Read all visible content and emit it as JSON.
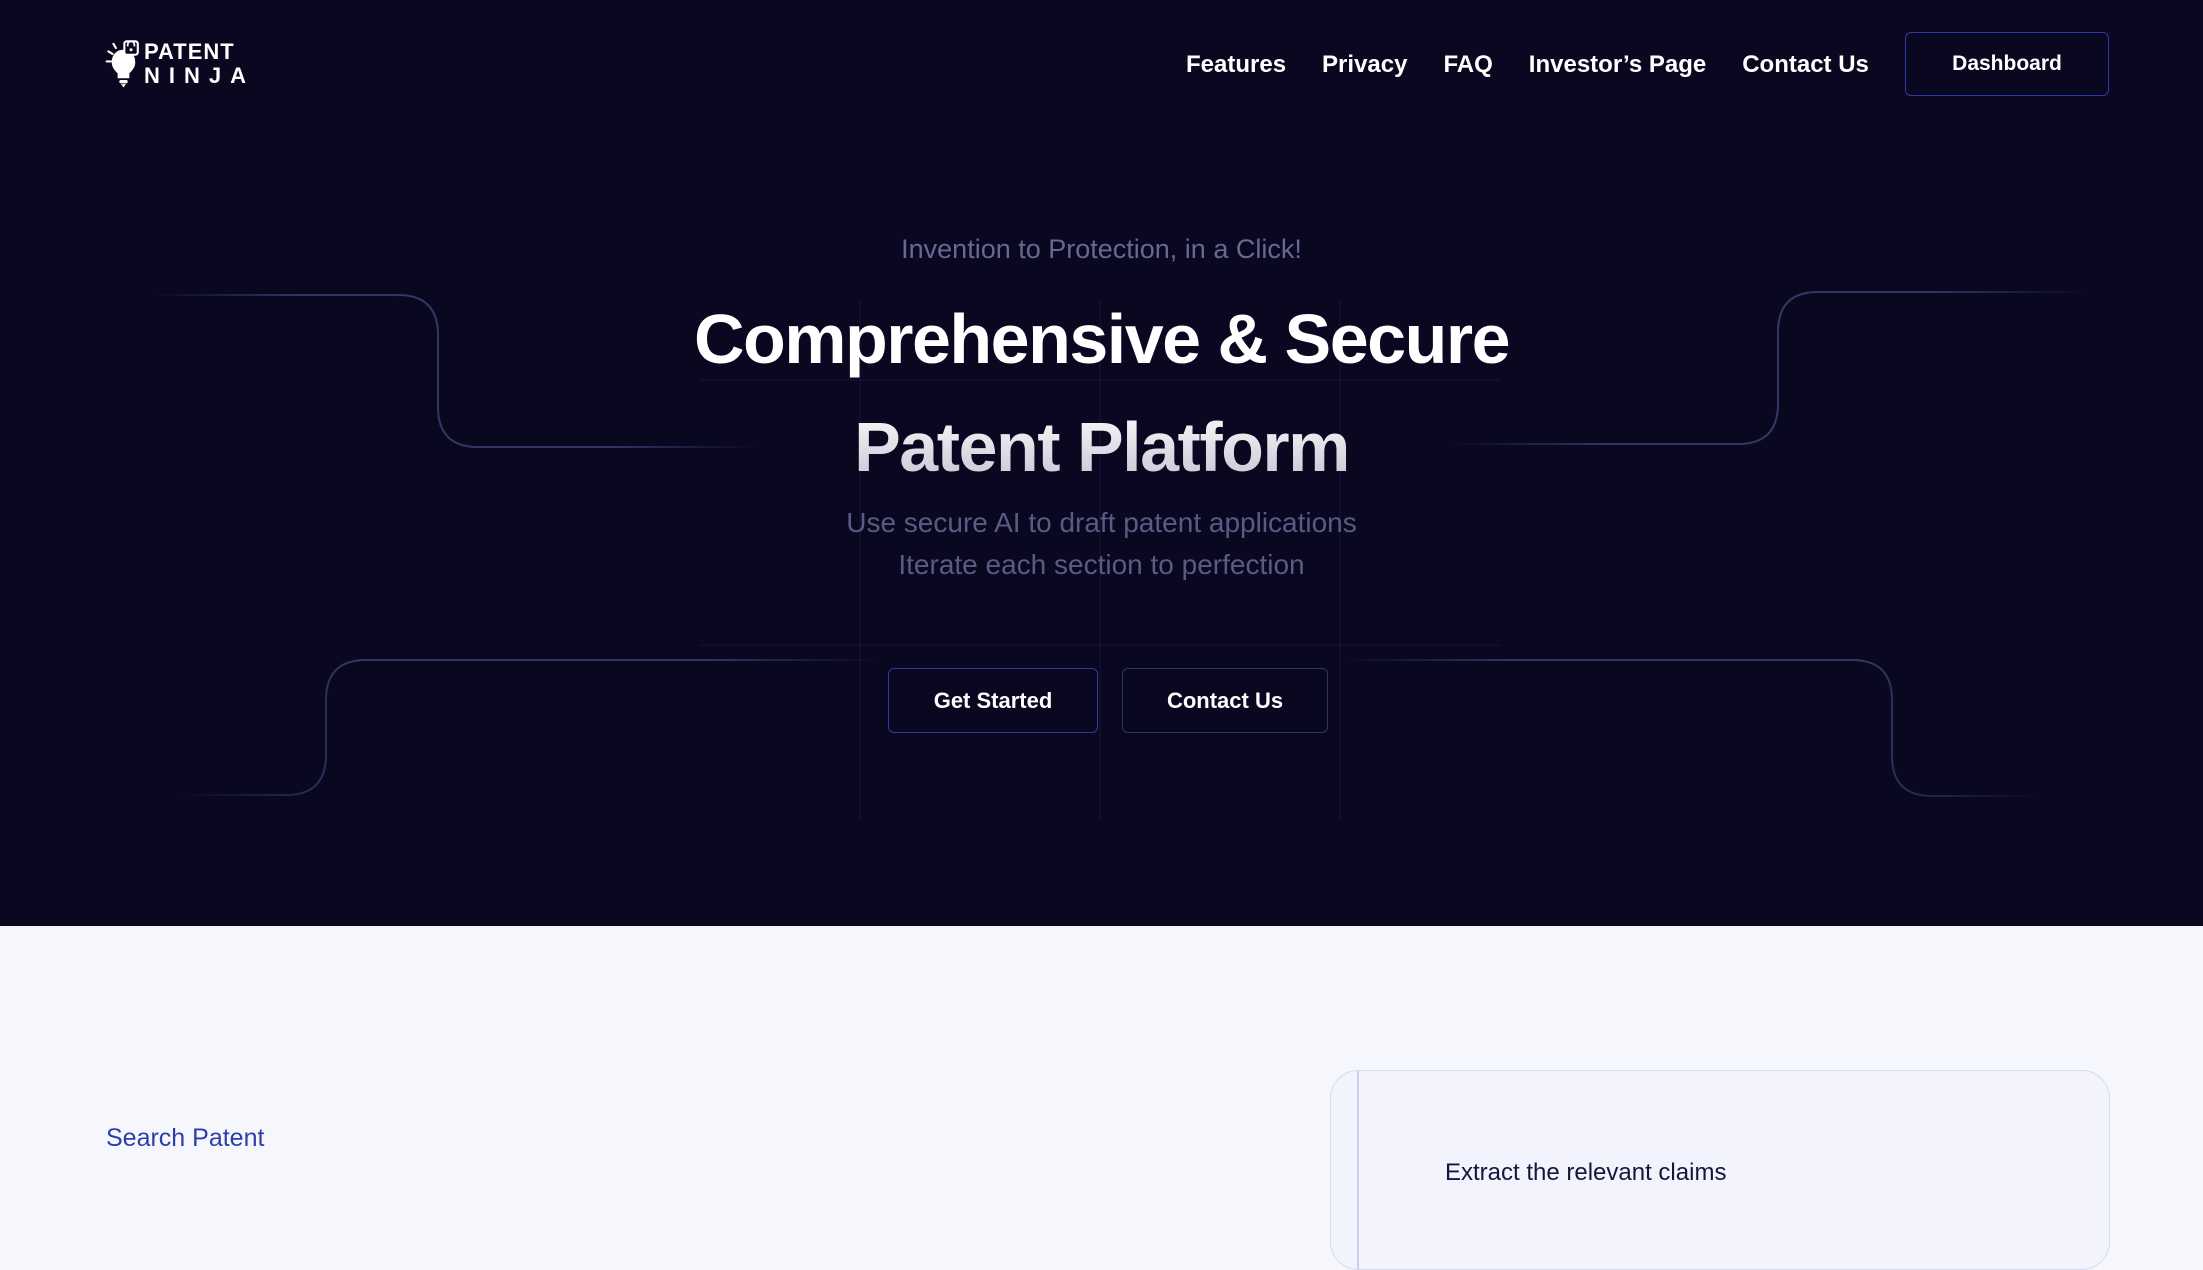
{
  "brand": {
    "logo_line1": "PATENT",
    "logo_line2": "NINJA"
  },
  "nav": {
    "links": [
      "Features",
      "Privacy",
      "FAQ",
      "Investor’s Page",
      "Contact Us"
    ],
    "dashboard_label": "Dashboard"
  },
  "hero": {
    "eyebrow": "Invention to Protection, in a Click!",
    "headline_line1": "Comprehensive & Secure",
    "headline_line2": "Patent Platform",
    "sub_line1": "Use secure AI to draft patent applications",
    "sub_line2": "Iterate each section to perfection",
    "primary_cta": "Get Started",
    "secondary_cta": "Contact Us"
  },
  "features": {
    "section_label": "Search Patent",
    "card_text": "Extract the relevant claims"
  },
  "colors": {
    "hero_bg": "#0a0720",
    "page_bg": "#f6f7fd",
    "accent": "#2f3aa0",
    "label_blue": "#2a3fa8"
  }
}
